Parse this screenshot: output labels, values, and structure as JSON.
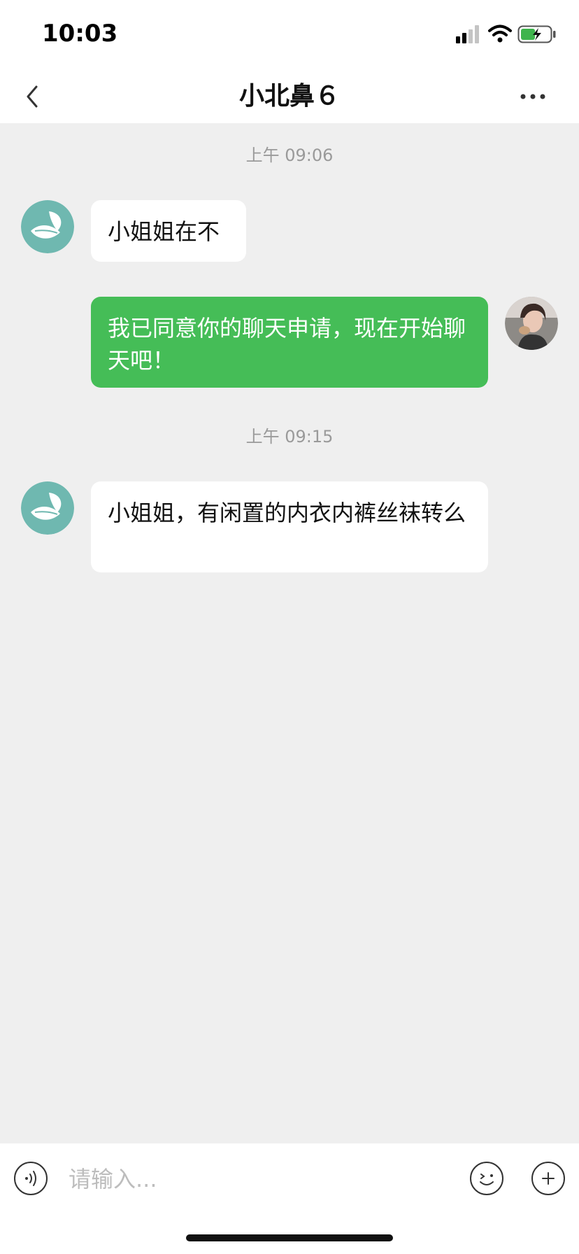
{
  "status_bar": {
    "time": "10:03"
  },
  "header": {
    "title": "小北鼻６"
  },
  "messages": [
    {
      "type": "time",
      "text": "上午 09:06"
    },
    {
      "type": "incoming",
      "text": "小姐姐在不"
    },
    {
      "type": "outgoing",
      "text": "我已同意你的聊天申请，现在开始聊天吧！"
    },
    {
      "type": "time",
      "text": "上午 09:15"
    },
    {
      "type": "incoming",
      "text": "小姐姐，有闲置的内衣内裤丝袜转么"
    }
  ],
  "input": {
    "placeholder": "请输入..."
  },
  "colors": {
    "outgoing_bubble": "#45bd57",
    "incoming_bubble": "#ffffff",
    "chat_background": "#efefef",
    "contact_avatar": "#6fb8b0"
  },
  "icons": {
    "back": "chevron-left-icon",
    "more": "more-dots-icon",
    "voice": "voice-icon",
    "emoji": "emoji-icon",
    "plus": "plus-icon"
  }
}
